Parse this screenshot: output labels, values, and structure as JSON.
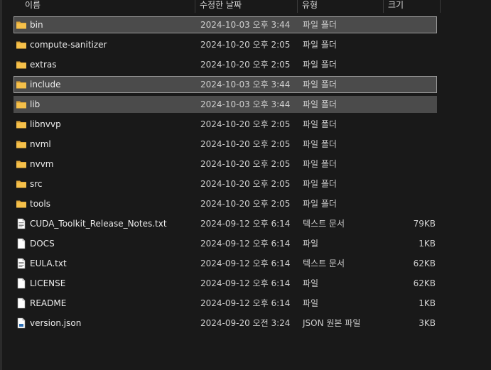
{
  "columns": {
    "name": "이름",
    "date": "수정한 날짜",
    "type": "유형",
    "size": "크기"
  },
  "files": [
    {
      "name": "bin",
      "date": "2024-10-03 오후 3:44",
      "type": "파일 폴더",
      "size": "",
      "icon": "folder-icon",
      "state": "selected"
    },
    {
      "name": "compute-sanitizer",
      "date": "2024-10-20 오후 2:05",
      "type": "파일 폴더",
      "size": "",
      "icon": "folder-icon",
      "state": ""
    },
    {
      "name": "extras",
      "date": "2024-10-20 오후 2:05",
      "type": "파일 폴더",
      "size": "",
      "icon": "folder-icon",
      "state": ""
    },
    {
      "name": "include",
      "date": "2024-10-03 오후 3:44",
      "type": "파일 폴더",
      "size": "",
      "icon": "folder-icon",
      "state": "selected"
    },
    {
      "name": "lib",
      "date": "2024-10-03 오후 3:44",
      "type": "파일 폴더",
      "size": "",
      "icon": "folder-icon",
      "state": "selected-fill"
    },
    {
      "name": "libnvvp",
      "date": "2024-10-20 오후 2:05",
      "type": "파일 폴더",
      "size": "",
      "icon": "folder-icon",
      "state": ""
    },
    {
      "name": "nvml",
      "date": "2024-10-20 오후 2:05",
      "type": "파일 폴더",
      "size": "",
      "icon": "folder-icon",
      "state": ""
    },
    {
      "name": "nvvm",
      "date": "2024-10-20 오후 2:05",
      "type": "파일 폴더",
      "size": "",
      "icon": "folder-icon",
      "state": ""
    },
    {
      "name": "src",
      "date": "2024-10-20 오후 2:05",
      "type": "파일 폴더",
      "size": "",
      "icon": "folder-icon",
      "state": ""
    },
    {
      "name": "tools",
      "date": "2024-10-20 오후 2:05",
      "type": "파일 폴더",
      "size": "",
      "icon": "folder-icon",
      "state": ""
    },
    {
      "name": "CUDA_Toolkit_Release_Notes.txt",
      "date": "2024-09-12 오후 6:14",
      "type": "텍스트 문서",
      "size": "79KB",
      "icon": "text-document-icon",
      "state": ""
    },
    {
      "name": "DOCS",
      "date": "2024-09-12 오후 6:14",
      "type": "파일",
      "size": "1KB",
      "icon": "file-icon",
      "state": ""
    },
    {
      "name": "EULA.txt",
      "date": "2024-09-12 오후 6:14",
      "type": "텍스트 문서",
      "size": "62KB",
      "icon": "text-document-icon",
      "state": ""
    },
    {
      "name": "LICENSE",
      "date": "2024-09-12 오후 6:14",
      "type": "파일",
      "size": "62KB",
      "icon": "file-icon",
      "state": ""
    },
    {
      "name": "README",
      "date": "2024-09-12 오후 6:14",
      "type": "파일",
      "size": "1KB",
      "icon": "file-icon",
      "state": ""
    },
    {
      "name": "version.json",
      "date": "2024-09-20 오전 3:24",
      "type": "JSON 원본 파일",
      "size": "3KB",
      "icon": "json-file-icon",
      "state": ""
    }
  ],
  "colors": {
    "background": "#191919",
    "selected_row": "#4b4b4b",
    "selected_border": "#9a9a9a",
    "folder_yellow": "#f5c04a"
  }
}
